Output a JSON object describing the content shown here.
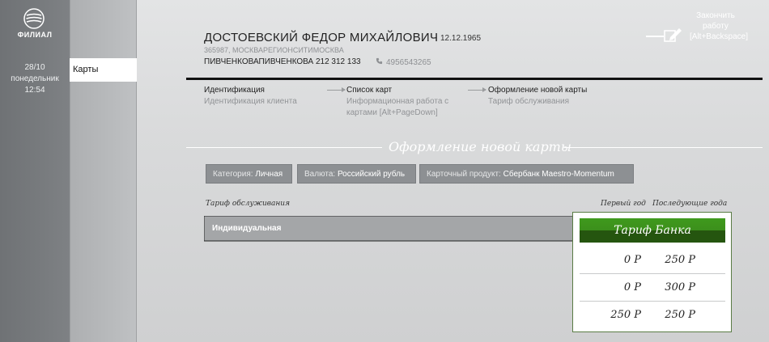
{
  "branch": {
    "logo_icon": "sber-logo-icon",
    "label": "ФИЛИАЛ",
    "date": "28/10",
    "weekday": "понедельник",
    "time": "12:54"
  },
  "nav": {
    "cards": "Карты"
  },
  "client": {
    "name": "ДОСТОЕВСКИЙ ФЕДОР МИХАЙЛОВИЧ",
    "dob": "12.12.1965",
    "address": "365987, МОСКВАРЕГИОНСИТИМОСКВА",
    "passport": "ПИВЧЕНКОВАПИВЧЕНКОВА 212 312 133",
    "phone": "4956543265"
  },
  "header": {
    "exit_line1": "Закончить",
    "exit_line2": "работу",
    "exit_line3": "[Alt+Backspace]"
  },
  "steps": [
    {
      "title": "Идентификация",
      "sub1": "Идентификация клиента",
      "sub2": ""
    },
    {
      "title": "Список карт",
      "sub1": "Информационная работа с",
      "sub2": "картами [Alt+PageDown]"
    },
    {
      "title": "Оформление новой карты",
      "sub1": "Тариф обслуживания",
      "sub2": ""
    }
  ],
  "section": {
    "title": "Оформление новой карты"
  },
  "filters": [
    {
      "label": "Категория:",
      "value": "Личная"
    },
    {
      "label": "Валюта:",
      "value": "Российский рубль"
    },
    {
      "label": "Карточный продукт:",
      "value": "Сбербанк Maestro-Momentum"
    }
  ],
  "table": {
    "col_tariff": "Тариф обслуживания",
    "col_first_year": "Первый год",
    "col_next_years": "Последующие года",
    "selected_tariff": "Индивидуальная"
  },
  "bank_tariff": {
    "title": "Тариф Банка",
    "rows": [
      {
        "first": "0 Р",
        "next": "250 Р"
      },
      {
        "first": "0 Р",
        "next": "300 Р"
      },
      {
        "first": "250 Р",
        "next": "250 Р"
      }
    ]
  },
  "colors": {
    "accent_green": "#3f9a1d",
    "dark_green": "#25550f",
    "chip_bg": "#8d9093"
  }
}
